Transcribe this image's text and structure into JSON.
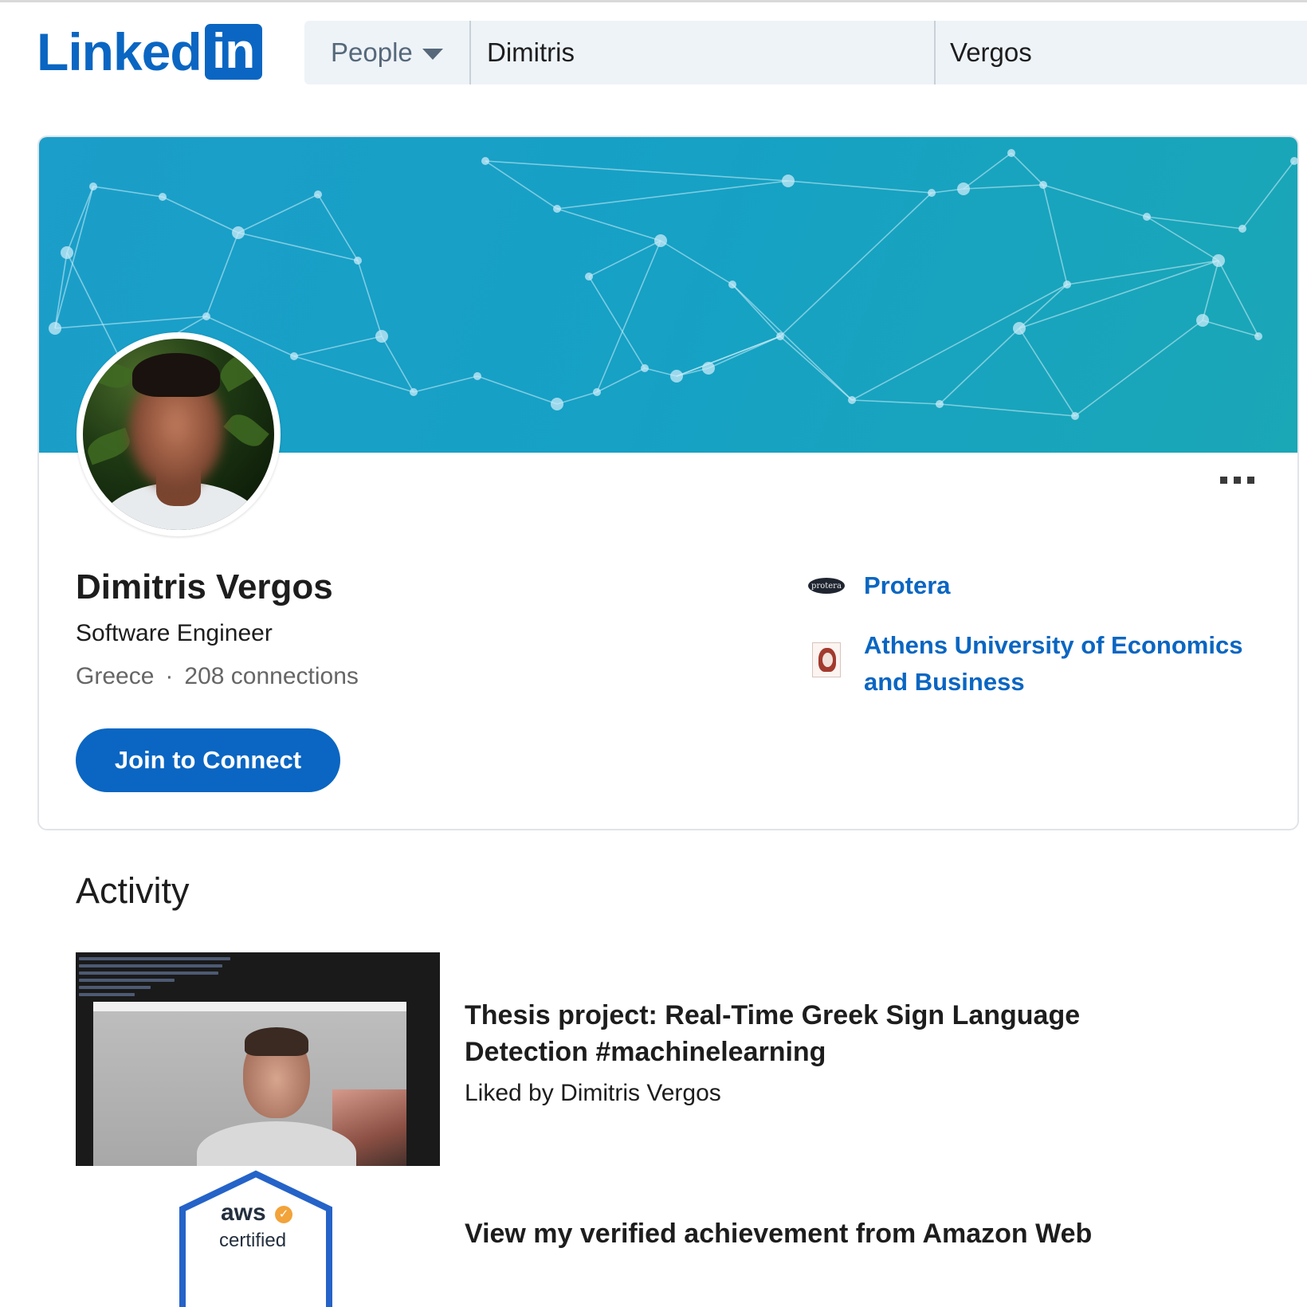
{
  "header": {
    "logo_word": "Linked",
    "logo_box": "in",
    "search_type": "People",
    "first_name": "Dimitris",
    "last_name": "Vergos"
  },
  "profile": {
    "name": "Dimitris Vergos",
    "headline": "Software Engineer",
    "location": "Greece",
    "separator": "·",
    "connections": "208 connections",
    "join_button": "Join to Connect",
    "experience": [
      {
        "logo_text": "protera",
        "label": "Protera"
      },
      {
        "label": "Athens University of Economics and Business"
      }
    ]
  },
  "activity": {
    "title": "Activity",
    "posts": [
      {
        "title": "Thesis project: Real-Time Greek Sign Language Detection #machinelearning",
        "subtitle": "Liked by Dimitris Vergos"
      },
      {
        "title": "View my verified achievement from Amazon Web",
        "badge_brand": "aws",
        "badge_text": "certified"
      }
    ]
  },
  "colors": {
    "brand": "#0a66c2",
    "banner": "#1b9ec9",
    "text": "#1d1d1d",
    "muted": "#666666"
  },
  "icons": [
    "dropdown-caret-icon",
    "more-options-icon",
    "protera-logo-icon",
    "aueb-logo-icon",
    "aws-certified-badge-icon"
  ]
}
